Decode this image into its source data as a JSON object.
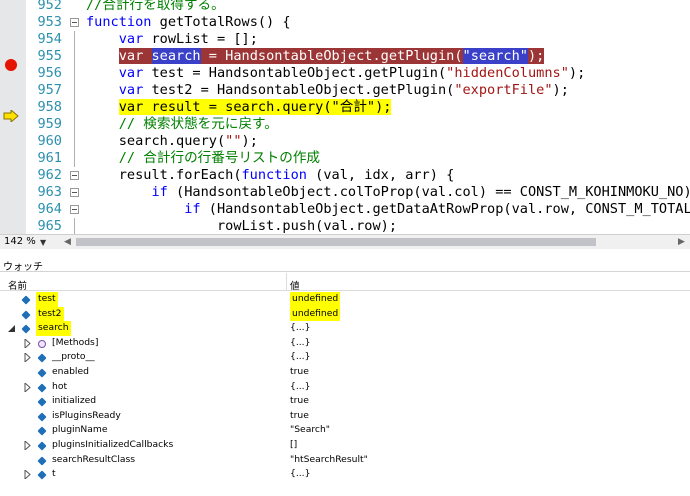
{
  "editor": {
    "lines": [
      {
        "no": "952",
        "tokens": [
          {
            "t": "//合計行を取得する。",
            "c": "cm"
          }
        ]
      },
      {
        "no": "953",
        "tokens": [
          {
            "t": "function",
            "c": "kw"
          },
          {
            "t": " getTotalRows() {",
            "c": ""
          }
        ]
      },
      {
        "no": "954",
        "tokens": [
          {
            "t": "    ",
            "c": ""
          },
          {
            "t": "var",
            "c": "kw"
          },
          {
            "t": " rowList = [];",
            "c": ""
          }
        ]
      },
      {
        "no": "955",
        "tokens": [
          {
            "t": "    ",
            "c": ""
          },
          {
            "t": "var ",
            "c": "hl-bp"
          },
          {
            "t": "search",
            "c": "hl-sel"
          },
          {
            "t": " = HandsontableObject.getPlugin(",
            "c": "hl-bp"
          },
          {
            "t": "\"search\"",
            "c": "hl-sel"
          },
          {
            "t": ");",
            "c": "hl-bp"
          }
        ]
      },
      {
        "no": "956",
        "tokens": [
          {
            "t": "    ",
            "c": ""
          },
          {
            "t": "var",
            "c": "kw"
          },
          {
            "t": " test = HandsontableObject.getPlugin(",
            "c": ""
          },
          {
            "t": "\"hiddenColumns\"",
            "c": "str"
          },
          {
            "t": ");",
            "c": ""
          }
        ]
      },
      {
        "no": "957",
        "tokens": [
          {
            "t": "    ",
            "c": ""
          },
          {
            "t": "var",
            "c": "kw"
          },
          {
            "t": " test2 = HandsontableObject.getPlugin(",
            "c": ""
          },
          {
            "t": "\"exportFile\"",
            "c": "str"
          },
          {
            "t": ");",
            "c": ""
          }
        ]
      },
      {
        "no": "958",
        "tokens": [
          {
            "t": "    ",
            "c": ""
          },
          {
            "t": "var result = search.query(\"合計\");",
            "c": "hl-y"
          }
        ]
      },
      {
        "no": "959",
        "tokens": [
          {
            "t": "    ",
            "c": ""
          },
          {
            "t": "// 検索状態を元に戻す。",
            "c": "cm"
          }
        ]
      },
      {
        "no": "960",
        "tokens": [
          {
            "t": "    search.query(",
            "c": ""
          },
          {
            "t": "\"\"",
            "c": "str"
          },
          {
            "t": ");",
            "c": ""
          }
        ]
      },
      {
        "no": "961",
        "tokens": [
          {
            "t": "    ",
            "c": ""
          },
          {
            "t": "// 合計行の行番号リストの作成",
            "c": "cm"
          }
        ]
      },
      {
        "no": "962",
        "tokens": [
          {
            "t": "    result.forEach(",
            "c": ""
          },
          {
            "t": "function",
            "c": "kw"
          },
          {
            "t": " (val, idx, arr) {",
            "c": ""
          }
        ]
      },
      {
        "no": "963",
        "tokens": [
          {
            "t": "        ",
            "c": ""
          },
          {
            "t": "if",
            "c": "kw"
          },
          {
            "t": " (HandsontableObject.colToProp(val.col) == CONST_M_KOHINMOKU_NO) {",
            "c": ""
          }
        ]
      },
      {
        "no": "964",
        "tokens": [
          {
            "t": "            ",
            "c": ""
          },
          {
            "t": "if",
            "c": "kw"
          },
          {
            "t": " (HandsontableObject.getDataAtRowProp(val.row, CONST_M_TOTAL_R",
            "c": ""
          }
        ]
      },
      {
        "no": "965",
        "tokens": [
          {
            "t": "                rowList.push(val.row);",
            "c": ""
          }
        ]
      }
    ]
  },
  "statusbar": {
    "zoom": "142 %"
  },
  "watch": {
    "title": "ウォッチ",
    "col_name": "名前",
    "col_value": "値",
    "rows": [
      {
        "name": "test",
        "value": "undefined"
      },
      {
        "name": "test2",
        "value": "undefined"
      },
      {
        "name": "search",
        "value": "{...}"
      },
      {
        "name": "[Methods]",
        "value": "{...}"
      },
      {
        "name": "__proto__",
        "value": "{...}"
      },
      {
        "name": "enabled",
        "value": "true"
      },
      {
        "name": "hot",
        "value": "{...}"
      },
      {
        "name": "initialized",
        "value": "true"
      },
      {
        "name": "isPluginsReady",
        "value": "true"
      },
      {
        "name": "pluginName",
        "value": "\"Search\""
      },
      {
        "name": "pluginsInitializedCallbacks",
        "value": "[]"
      },
      {
        "name": "searchResultClass",
        "value": "\"htSearchResult\""
      },
      {
        "name": "t",
        "value": "{...}"
      }
    ]
  },
  "colors": {
    "keyword": "#0000ff",
    "string": "#a31515",
    "comment": "#008000",
    "breakpoint": "#e51400",
    "highlight": "#ffff00",
    "line_number": "#2b91af"
  },
  "icons": {
    "breakpoint": "breakpoint-icon",
    "current_statement": "current-statement-arrow-icon",
    "variable": "field-icon",
    "method": "method-icon",
    "expand": "expand-triangle-icon",
    "collapse": "collapse-triangle-icon"
  }
}
